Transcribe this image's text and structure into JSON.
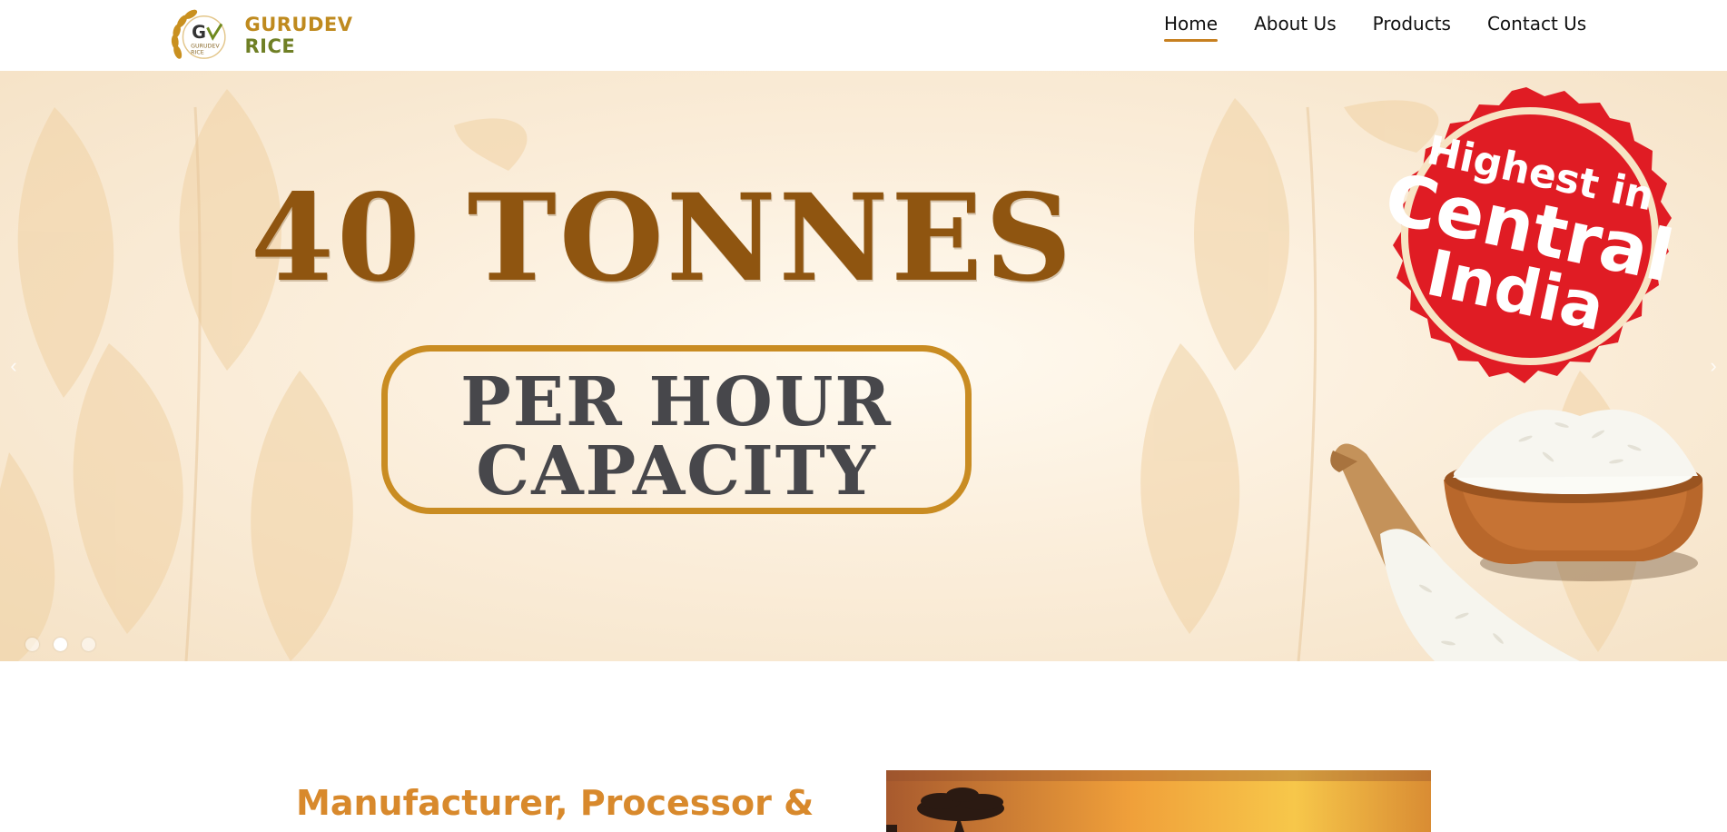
{
  "header": {
    "logo": {
      "mark_text": "GURUDEV RICE",
      "brand_name": "GURUDEV RICE",
      "brand_color": "#bf8a1e",
      "brand_accent": "#6f7f25"
    },
    "nav": [
      {
        "label": "Home",
        "active": true
      },
      {
        "label": "About Us",
        "active": false
      },
      {
        "label": "Products",
        "active": false
      },
      {
        "label": "Contact Us",
        "active": false
      }
    ],
    "active_underline_color": "#c78020"
  },
  "hero": {
    "headline": "40 TONNES",
    "capacity_line1": "PER HOUR",
    "capacity_line2": "CAPACITY",
    "seal": {
      "line1": "Highest in",
      "line2": "Central",
      "line3": "India",
      "color": "#e01c24"
    },
    "prev_icon": "chevron-left-icon",
    "next_icon": "chevron-right-icon",
    "slide_dots": [
      {
        "active": false
      },
      {
        "active": true
      },
      {
        "active": false
      }
    ],
    "headline_color": "#8f5510",
    "capacity_color": "#47474b"
  },
  "intro": {
    "title": "Manufacturer, Processor &",
    "title_color": "#d8892c"
  }
}
